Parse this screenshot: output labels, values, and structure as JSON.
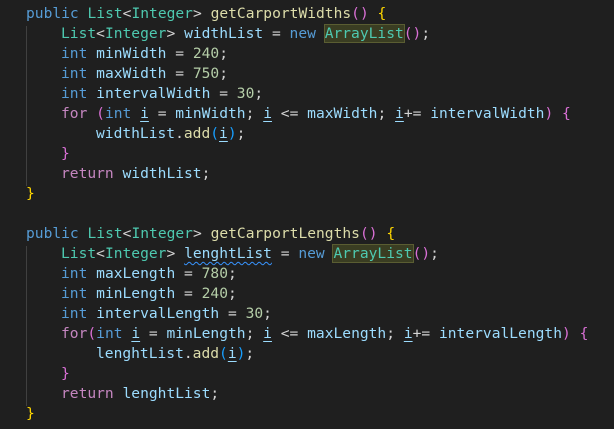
{
  "code": {
    "language": "java",
    "method1": {
      "modifier": "public",
      "return_type": "List",
      "generic": "Integer",
      "name": "getCarportWidths",
      "list_var": "widthList",
      "new_kw": "new",
      "impl_class": "ArrayList",
      "vars": [
        {
          "type": "int",
          "name": "minWidth",
          "value": "240"
        },
        {
          "type": "int",
          "name": "maxWidth",
          "value": "750"
        },
        {
          "type": "int",
          "name": "intervalWidth",
          "value": "30"
        }
      ],
      "loop_kw": "for",
      "loop_type": "int",
      "loop_var": "i",
      "loop_start": "minWidth",
      "loop_cmp": "<=",
      "loop_end": "maxWidth",
      "loop_inc_op": "+=",
      "loop_inc": "intervalWidth",
      "add_call": "add",
      "return_kw": "return",
      "return_var": "widthList"
    },
    "method2": {
      "modifier": "public",
      "return_type": "List",
      "generic": "Integer",
      "name": "getCarportLengths",
      "list_var": "lenghtList",
      "new_kw": "new",
      "impl_class": "ArrayList",
      "vars": [
        {
          "type": "int",
          "name": "maxLength",
          "value": "780"
        },
        {
          "type": "int",
          "name": "minLength",
          "value": "240"
        },
        {
          "type": "int",
          "name": "intervalLength",
          "value": "30"
        }
      ],
      "loop_kw": "for",
      "loop_type": "int",
      "loop_var": "i",
      "loop_start": "minLength",
      "loop_cmp": "<=",
      "loop_end": "maxLength",
      "loop_inc_op": "+=",
      "loop_inc": "intervalLength",
      "add_call": "add",
      "return_kw": "return",
      "return_var": "lenghtList"
    }
  },
  "colors": {
    "background": "#1f1f1f",
    "keyword": "#c586c0",
    "primitive": "#569cd6",
    "type": "#4ec9b0",
    "function": "#dcdcaa",
    "variable": "#9cdcfe",
    "number": "#b5cea8",
    "bracket_level1": "#ffd700",
    "bracket_level2": "#da70d6",
    "bracket_level3": "#179fff"
  }
}
